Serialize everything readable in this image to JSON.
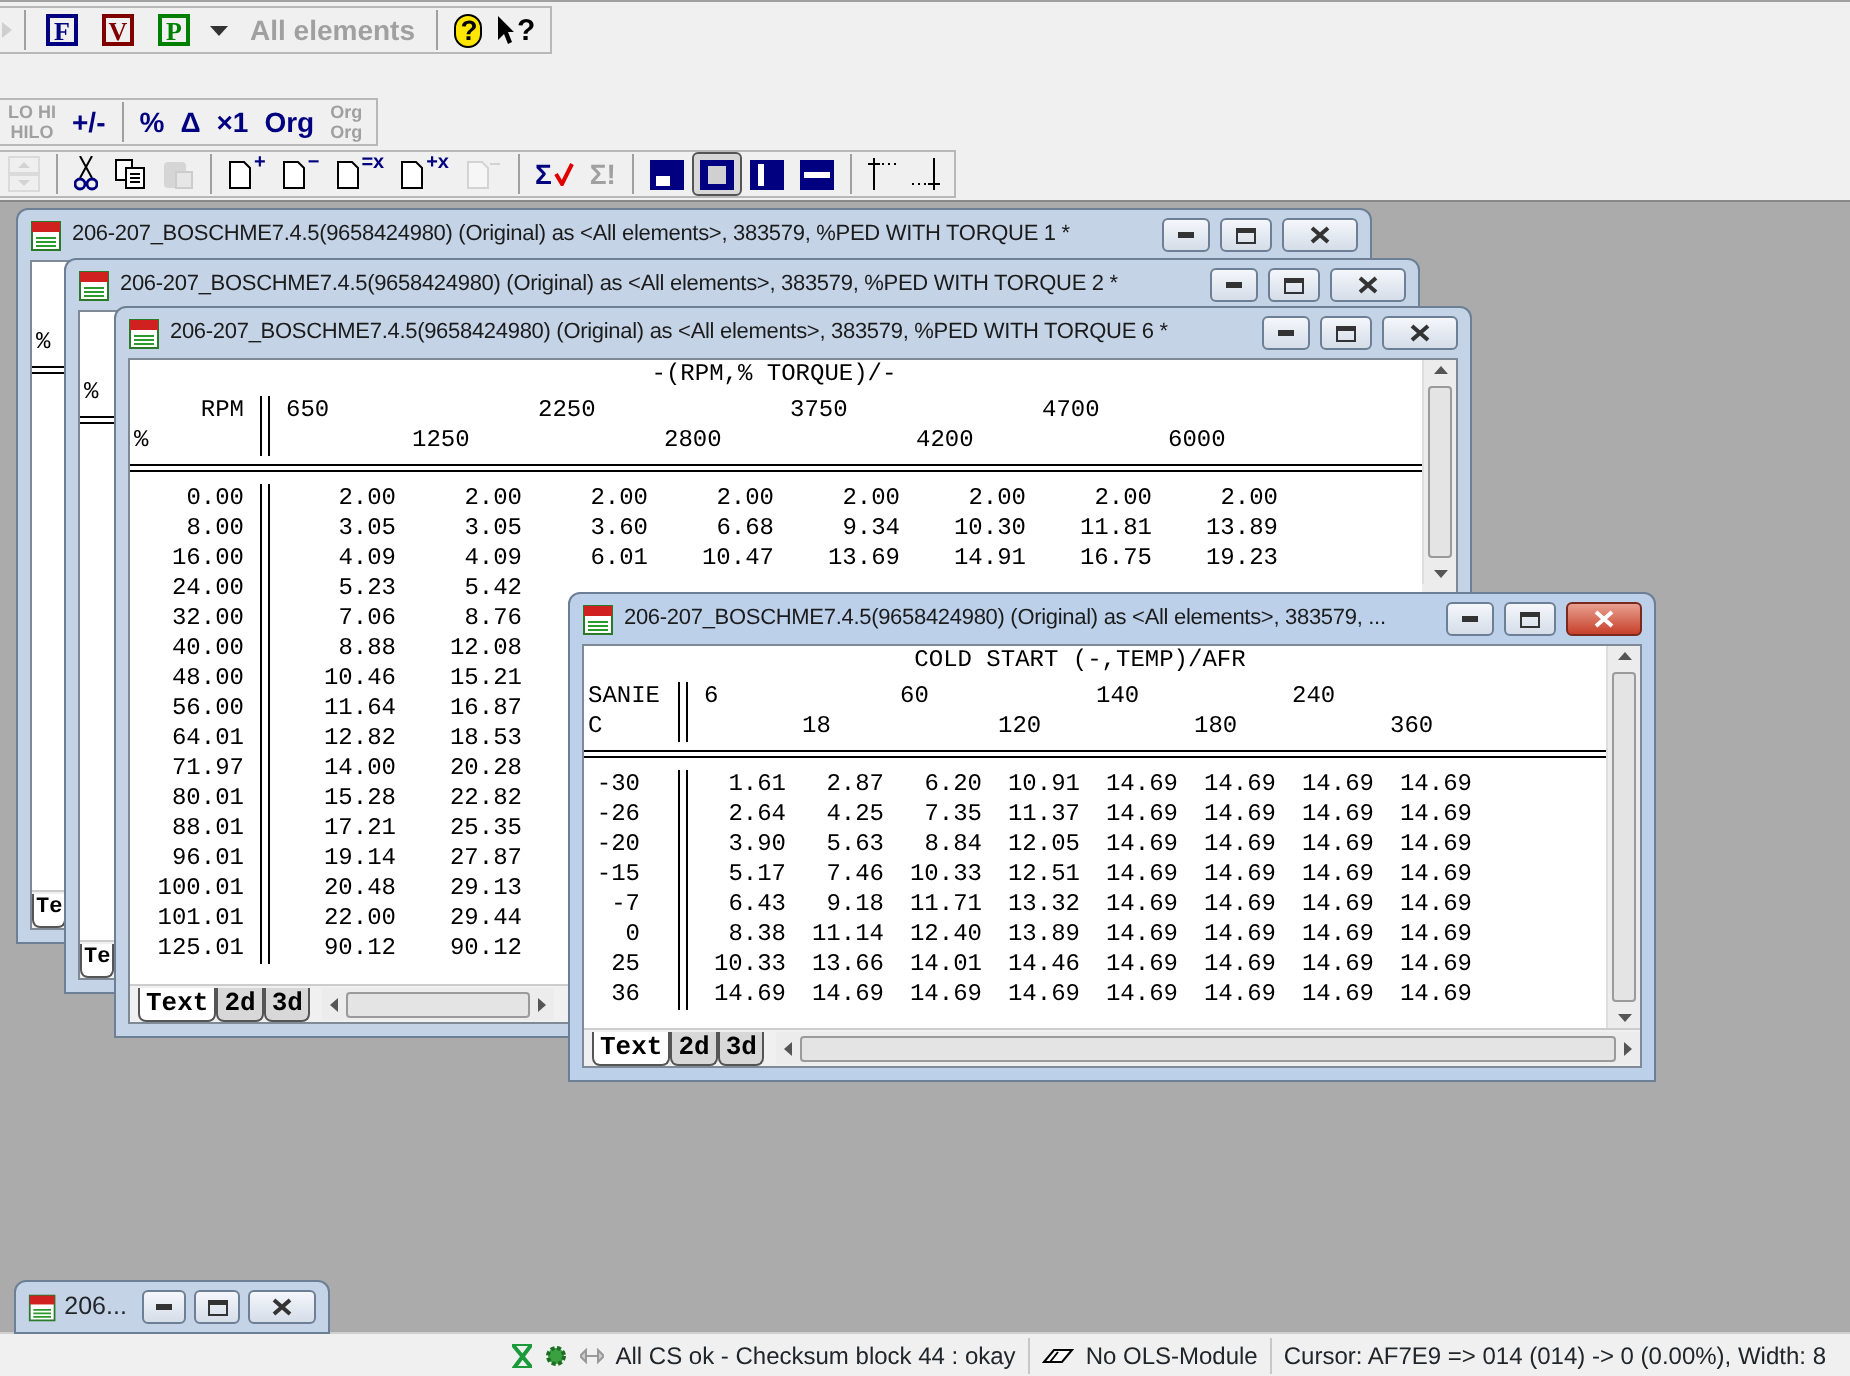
{
  "toolbars": [
    {
      "items": [
        {
          "kind": "arrow",
          "disabled": true
        },
        {
          "kind": "sep"
        },
        {
          "kind": "boxed",
          "label": "F",
          "color": "#000080",
          "disabled": false
        },
        {
          "kind": "boxed",
          "label": "V",
          "color": "#800000",
          "disabled": false
        },
        {
          "kind": "boxed",
          "label": "P",
          "color": "#008000",
          "disabled": false
        },
        {
          "kind": "caret",
          "disabled": false
        },
        {
          "kind": "text",
          "label": "All elements",
          "disabled": true
        },
        {
          "kind": "sep"
        },
        {
          "kind": "help",
          "label": "?",
          "disabled": false
        },
        {
          "kind": "context-help",
          "label": "?",
          "disabled": false
        }
      ]
    },
    {
      "items": [
        {
          "kind": "stack",
          "label": "LO HI",
          "label2": "HILO",
          "disabled": true
        },
        {
          "kind": "text",
          "label": "+/-",
          "disabled": false
        },
        {
          "kind": "sep"
        },
        {
          "kind": "text",
          "label": "%",
          "disabled": false
        },
        {
          "kind": "text",
          "label": "Δ",
          "disabled": false
        },
        {
          "kind": "text",
          "label": "×1",
          "disabled": false
        },
        {
          "kind": "text",
          "label": "Org",
          "disabled": false
        },
        {
          "kind": "stack",
          "label": "Org",
          "label2": "Org",
          "disabled": true
        }
      ]
    },
    {
      "items": [
        {
          "kind": "spinner",
          "disabled": true
        },
        {
          "kind": "sep"
        },
        {
          "kind": "scissors",
          "disabled": false
        },
        {
          "kind": "copy",
          "disabled": false
        },
        {
          "kind": "paste",
          "disabled": true
        },
        {
          "kind": "sep"
        },
        {
          "kind": "doc",
          "label": "+",
          "disabled": false
        },
        {
          "kind": "doc",
          "label": "−",
          "disabled": false
        },
        {
          "kind": "doc",
          "label": "=x",
          "disabled": false
        },
        {
          "kind": "doc",
          "label": "+x",
          "disabled": false
        },
        {
          "kind": "doc-plain",
          "disabled": true
        },
        {
          "kind": "sep"
        },
        {
          "kind": "sum-check",
          "label": "Σ",
          "disabled": false
        },
        {
          "kind": "text",
          "label": "Σ!",
          "disabled": true
        },
        {
          "kind": "sep"
        },
        {
          "kind": "view-corner",
          "selected": false
        },
        {
          "kind": "view-square",
          "selected": true
        },
        {
          "kind": "view-column",
          "selected": false
        },
        {
          "kind": "view-row",
          "selected": false
        },
        {
          "kind": "sep"
        },
        {
          "kind": "cursor-top",
          "disabled": false
        },
        {
          "kind": "cursor-bottom",
          "disabled": false
        }
      ]
    }
  ],
  "windows": [
    {
      "title": "206-207_BOSCHME7.4.5(9658424980) (Original) as <All elements>, 383579, %PED WITH TORQUE 1 *",
      "active": false,
      "row_axis_label": "%",
      "tabs": [
        {
          "label": "Te",
          "selected": true
        }
      ]
    },
    {
      "title": "206-207_BOSCHME7.4.5(9658424980) (Original) as <All elements>, 383579, %PED WITH TORQUE 2 *",
      "active": false,
      "row_axis_label": "%",
      "tabs": [
        {
          "label": "Te",
          "selected": true
        }
      ]
    },
    {
      "title": "206-207_BOSCHME7.4.5(9658424980) (Original) as <All elements>, 383579, %PED WITH TORQUE 6 *",
      "active": false,
      "map_title": "-(RPM,% TORQUE)/-",
      "column_axis_label": "RPM",
      "row_axis_label": "%",
      "columns": [
        "650",
        "1250",
        "2250",
        "2800",
        "3750",
        "4200",
        "4700",
        "6000"
      ],
      "rows": [
        {
          "label": "0.00",
          "values": [
            "2.00",
            "2.00",
            "2.00",
            "2.00",
            "2.00",
            "2.00",
            "2.00",
            "2.00"
          ]
        },
        {
          "label": "8.00",
          "values": [
            "3.05",
            "3.05",
            "3.60",
            "6.68",
            "9.34",
            "10.30",
            "11.81",
            "13.89"
          ]
        },
        {
          "label": "16.00",
          "values": [
            "4.09",
            "4.09",
            "6.01",
            "10.47",
            "13.69",
            "14.91",
            "16.75",
            "19.23"
          ]
        },
        {
          "label": "24.00",
          "values": [
            "5.23",
            "5.42"
          ]
        },
        {
          "label": "32.00",
          "values": [
            "7.06",
            "8.76"
          ]
        },
        {
          "label": "40.00",
          "values": [
            "8.88",
            "12.08"
          ]
        },
        {
          "label": "48.00",
          "values": [
            "10.46",
            "15.21"
          ]
        },
        {
          "label": "56.00",
          "values": [
            "11.64",
            "16.87"
          ]
        },
        {
          "label": "64.01",
          "values": [
            "12.82",
            "18.53"
          ]
        },
        {
          "label": "71.97",
          "values": [
            "14.00",
            "20.28"
          ]
        },
        {
          "label": "80.01",
          "values": [
            "15.28",
            "22.82"
          ]
        },
        {
          "label": "88.01",
          "values": [
            "17.21",
            "25.35"
          ]
        },
        {
          "label": "96.01",
          "values": [
            "19.14",
            "27.87"
          ]
        },
        {
          "label": "100.01",
          "values": [
            "20.48",
            "29.13"
          ]
        },
        {
          "label": "101.01",
          "values": [
            "22.00",
            "29.44"
          ]
        },
        {
          "label": "125.01",
          "values": [
            "90.12",
            "90.12"
          ]
        }
      ],
      "tabs": [
        {
          "label": "Text",
          "selected": true
        },
        {
          "label": "2d",
          "selected": false
        },
        {
          "label": "3d",
          "selected": false
        }
      ]
    },
    {
      "title": "206-207_BOSCHME7.4.5(9658424980) (Original) as <All elements>, 383579, ...",
      "active": true,
      "map_title": "COLD START (-,TEMP)/AFR",
      "column_axis_label": "SANIE",
      "row_axis_label": "C",
      "columns": [
        "6",
        "18",
        "60",
        "120",
        "140",
        "180",
        "240",
        "360"
      ],
      "rows": [
        {
          "label": "-30",
          "values": [
            "1.61",
            "2.87",
            "6.20",
            "10.91",
            "14.69",
            "14.69",
            "14.69",
            "14.69"
          ]
        },
        {
          "label": "-26",
          "values": [
            "2.64",
            "4.25",
            "7.35",
            "11.37",
            "14.69",
            "14.69",
            "14.69",
            "14.69"
          ]
        },
        {
          "label": "-20",
          "values": [
            "3.90",
            "5.63",
            "8.84",
            "12.05",
            "14.69",
            "14.69",
            "14.69",
            "14.69"
          ]
        },
        {
          "label": "-15",
          "values": [
            "5.17",
            "7.46",
            "10.33",
            "12.51",
            "14.69",
            "14.69",
            "14.69",
            "14.69"
          ]
        },
        {
          "label": "-7",
          "values": [
            "6.43",
            "9.18",
            "11.71",
            "13.32",
            "14.69",
            "14.69",
            "14.69",
            "14.69"
          ]
        },
        {
          "label": "0",
          "values": [
            "8.38",
            "11.14",
            "12.40",
            "13.89",
            "14.69",
            "14.69",
            "14.69",
            "14.69"
          ]
        },
        {
          "label": "25",
          "values": [
            "10.33",
            "13.66",
            "14.01",
            "14.46",
            "14.69",
            "14.69",
            "14.69",
            "14.69"
          ]
        },
        {
          "label": "36",
          "values": [
            "14.69",
            "14.69",
            "14.69",
            "14.69",
            "14.69",
            "14.69",
            "14.69",
            "14.69"
          ]
        }
      ],
      "tabs": [
        {
          "label": "Text",
          "selected": true
        },
        {
          "label": "2d",
          "selected": false
        },
        {
          "label": "3d",
          "selected": false
        }
      ]
    }
  ],
  "minimized_window": {
    "title": "206..."
  },
  "status_bar": {
    "checksum_text": "All CS ok - Checksum block 44 : okay",
    "module_text": "No OLS-Module",
    "cursor_text": "Cursor: AF7E9 => 014 (014) -> 0 (0.00%), Width: 8"
  }
}
